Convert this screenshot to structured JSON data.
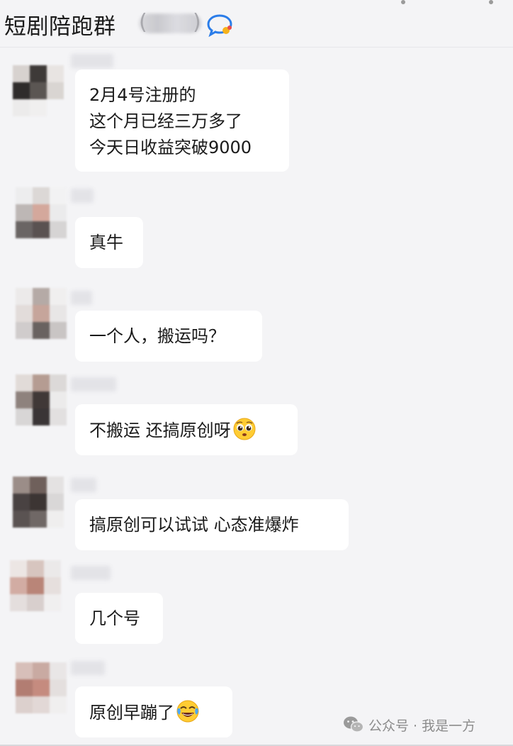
{
  "header": {
    "title": "短剧陪跑群",
    "chat_icon": "chat-bubble-icon"
  },
  "messages": [
    {
      "lines": [
        "2月4号注册的",
        "这个月已经三万多了",
        "今天日收益突破9000"
      ]
    },
    {
      "lines": [
        "真牛"
      ]
    },
    {
      "lines": [
        "一个人，搬运吗？"
      ]
    },
    {
      "lines": [
        "不搬运 还搞原创呀"
      ],
      "emoji": "pleading-face"
    },
    {
      "lines": [
        "搞原创可以试试 心态准爆炸"
      ]
    },
    {
      "lines": [
        "几个号"
      ]
    },
    {
      "lines": [
        "原创早蹦了"
      ],
      "emoji": "tears-of-joy-face"
    }
  ],
  "watermark": {
    "icon": "wechat-icon",
    "text": "公众号 · 我是一方"
  },
  "colors": {
    "background": "#f4f4f6",
    "bubble": "#ffffff",
    "accent_icon": "#2b7de9"
  }
}
